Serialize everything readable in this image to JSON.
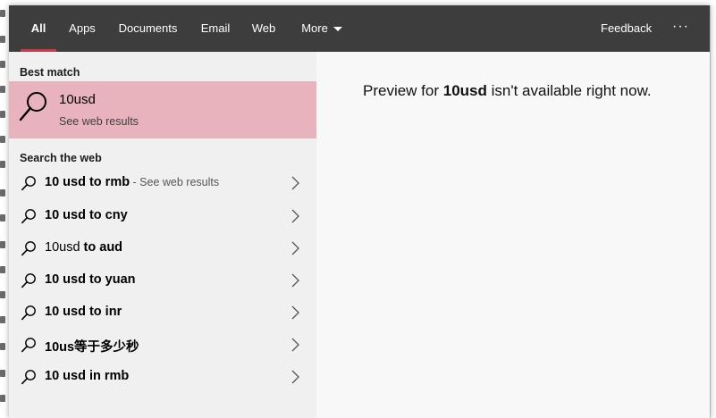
{
  "tabs": [
    {
      "label": "All",
      "active": true
    },
    {
      "label": "Apps",
      "active": false
    },
    {
      "label": "Documents",
      "active": false
    },
    {
      "label": "Email",
      "active": false
    },
    {
      "label": "Web",
      "active": false
    },
    {
      "label": "More",
      "active": false
    }
  ],
  "header": {
    "feedback_label": "Feedback",
    "more_options_label": "···",
    "more_chevron_icon": "chevron-down-icon"
  },
  "best_match": {
    "heading": "Best match",
    "title": "10usd",
    "subtitle": "See web results",
    "icon": "search-icon"
  },
  "web": {
    "heading": "Search the web",
    "suggestions": [
      {
        "prefix": "10 usd to rmb",
        "bold": "",
        "hint": " - See web results"
      },
      {
        "prefix": "10 usd to cny",
        "bold": "",
        "hint": ""
      },
      {
        "prefix": "10usd",
        "bold": " to aud",
        "hint": ""
      },
      {
        "prefix": "10 usd to yuan",
        "bold": "",
        "hint": ""
      },
      {
        "prefix": "10 usd to inr",
        "bold": "",
        "hint": ""
      },
      {
        "prefix": "10us等于多少秒",
        "bold": "",
        "hint": ""
      },
      {
        "prefix": "10 usd in rmb",
        "bold": "",
        "hint": ""
      }
    ]
  },
  "preview": {
    "before": "Preview for ",
    "query": "10usd",
    "after": " isn't available right now."
  },
  "colors": {
    "topbar": "#3d3d3d",
    "accent": "#c93a4a",
    "selected_row": "#e8b3bc"
  }
}
